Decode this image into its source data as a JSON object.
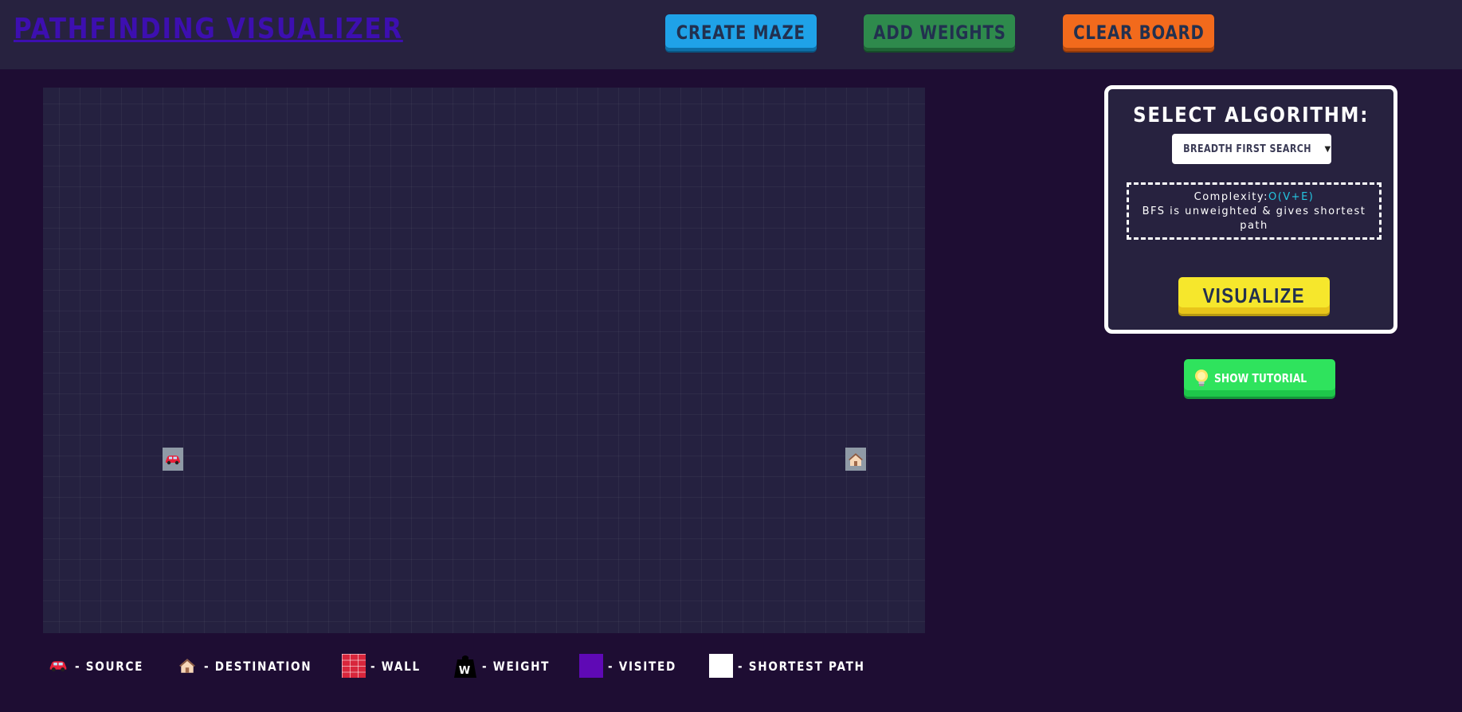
{
  "header": {
    "title": "PATHFINDING VISUALIZER",
    "create_maze_label": "CREATE MAZE",
    "add_weights_label": "ADD WEIGHTS",
    "clear_board_label": "CLEAR BOARD"
  },
  "grid": {
    "source_icon": "car-icon",
    "destination_icon": "house-icon"
  },
  "algorithm_panel": {
    "heading": "SELECT ALGORITHM:",
    "selected_algorithm": "BREADTH FIRST SEARCH",
    "complexity_label": "Complexity:",
    "complexity_value": "O(V+E)",
    "description": "BFS is unweighted & gives shortest path",
    "visualize_label": "VISUALIZE"
  },
  "tutorial": {
    "label": "SHOW TUTORIAL",
    "icon": "lightbulb-icon"
  },
  "legend": {
    "source": "- SOURCE",
    "destination": "- DESTINATION",
    "wall": "- WALL",
    "weight": "- WEIGHT",
    "weight_letter": "W",
    "visited": "- VISITED",
    "shortest_path": "- SHORTEST PATH"
  },
  "colors": {
    "background": "#1e0d33",
    "header": "#27223f",
    "title": "#3d0fb0",
    "create_maze": "#1fa2e8",
    "add_weights": "#2e8a4c",
    "clear_board": "#f26a1c",
    "visualize": "#f6e72c",
    "tutorial": "#2fe35d",
    "visited": "#5f09b5",
    "shortest_path": "#ffffff",
    "wall": "#d8263c",
    "complexity": "#24c6e0"
  }
}
